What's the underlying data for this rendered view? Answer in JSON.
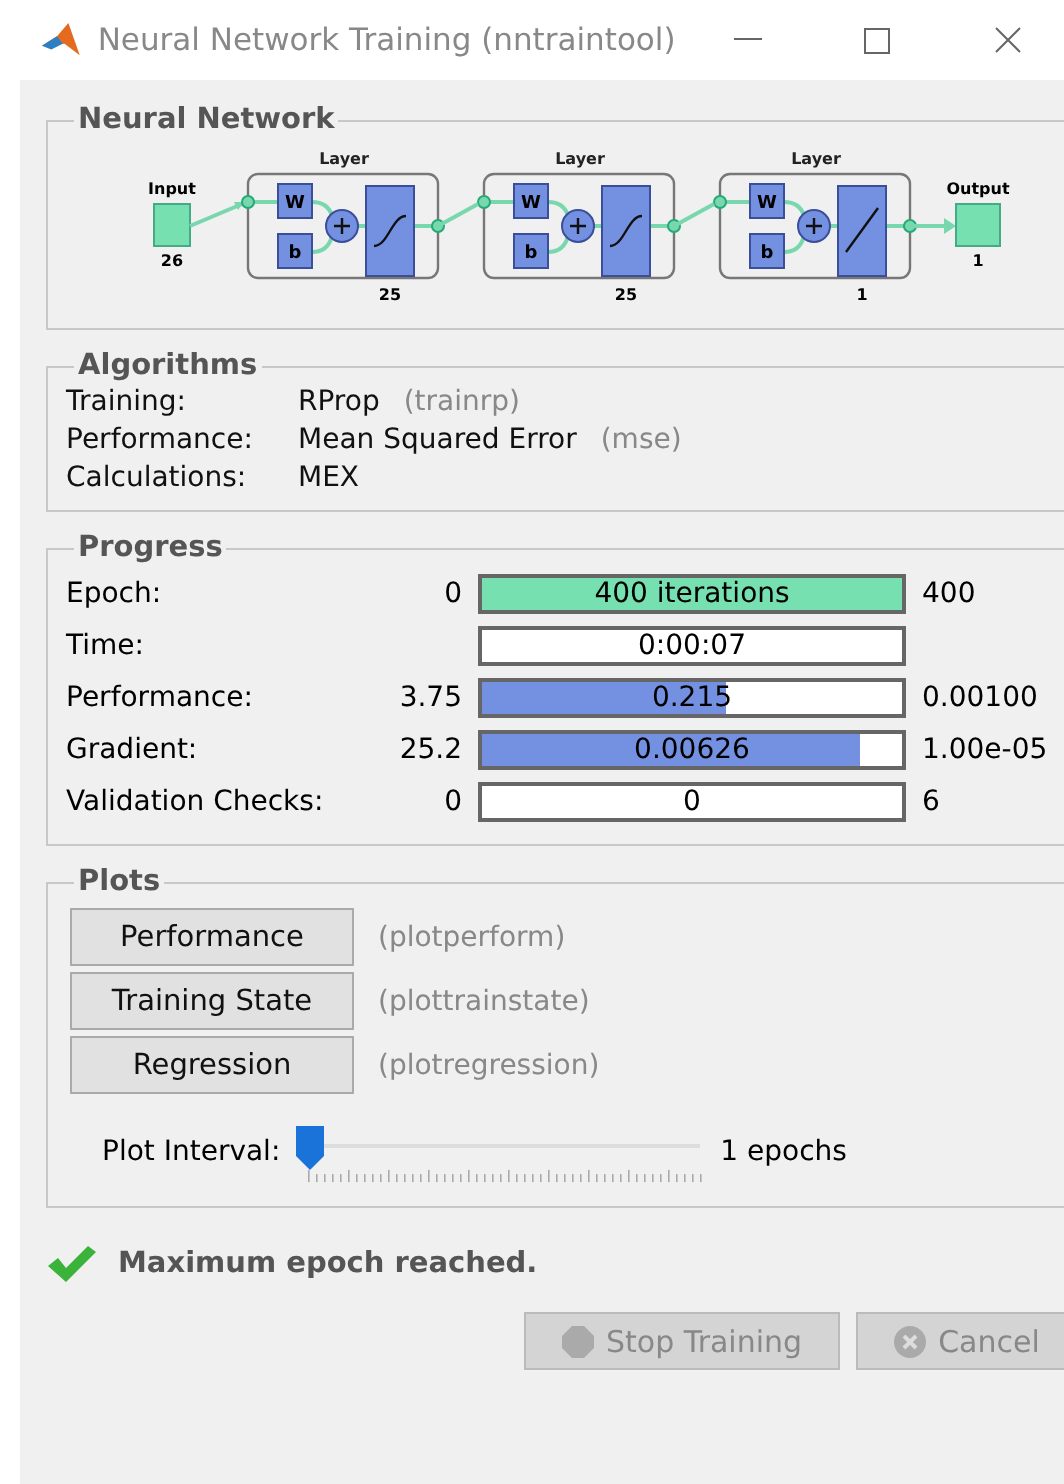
{
  "window": {
    "title": "Neural Network Training (nntraintool)"
  },
  "network": {
    "title": "Neural Network",
    "input": {
      "label": "Input",
      "size": "26"
    },
    "layers": [
      {
        "label": "Layer",
        "size": "25",
        "kind": "sigmoid",
        "weight_label": "W",
        "bias_label": "b"
      },
      {
        "label": "Layer",
        "size": "25",
        "kind": "sigmoid",
        "weight_label": "W",
        "bias_label": "b"
      },
      {
        "label": "Layer",
        "size": "1",
        "kind": "linear",
        "weight_label": "W",
        "bias_label": "b"
      }
    ],
    "output": {
      "label": "Output",
      "size": "1"
    }
  },
  "algorithms": {
    "title": "Algorithms",
    "rows": [
      {
        "label": "Training:",
        "value": "RProp",
        "code": "(trainrp)"
      },
      {
        "label": "Performance:",
        "value": "Mean Squared Error",
        "code": "(mse)"
      },
      {
        "label": "Calculations:",
        "value": "MEX"
      }
    ]
  },
  "progress": {
    "title": "Progress",
    "rows": [
      {
        "label": "Epoch:",
        "start": "0",
        "bar_text": "400 iterations",
        "level": 1,
        "color": "#77e0b0",
        "end": "400"
      },
      {
        "label": "Time:",
        "bar_text": "0:00:07"
      },
      {
        "label": "Performance:",
        "start": "3.75",
        "bar_text": "0.215",
        "level": 0.58,
        "color": "#7490e0",
        "end": "0.00100"
      },
      {
        "label": "Gradient:",
        "start": "25.2",
        "bar_text": "0.00626",
        "level": 0.9,
        "color": "#7490e0",
        "end": "1.00e-05"
      },
      {
        "label": "Validation Checks:",
        "start": "0",
        "bar_text": "0",
        "end": "6"
      }
    ]
  },
  "plots": {
    "title": "Plots",
    "buttons": [
      {
        "label": "Performance",
        "code": "(plotperform)",
        "disabled": false
      },
      {
        "label": "Training State",
        "code": "(plottrainstate)",
        "disabled": false
      },
      {
        "label": "Regression",
        "code": "(plotregression)",
        "disabled": false
      }
    ],
    "interval": {
      "label": "Plot Interval:",
      "level": 0,
      "reading": "1 epochs"
    }
  },
  "status": {
    "message": "Maximum epoch reached."
  },
  "buttons": [
    {
      "label": "Stop Training",
      "kind": "stop",
      "disabled": true
    },
    {
      "label": "Cancel",
      "kind": "cancel",
      "disabled": true
    }
  ]
}
